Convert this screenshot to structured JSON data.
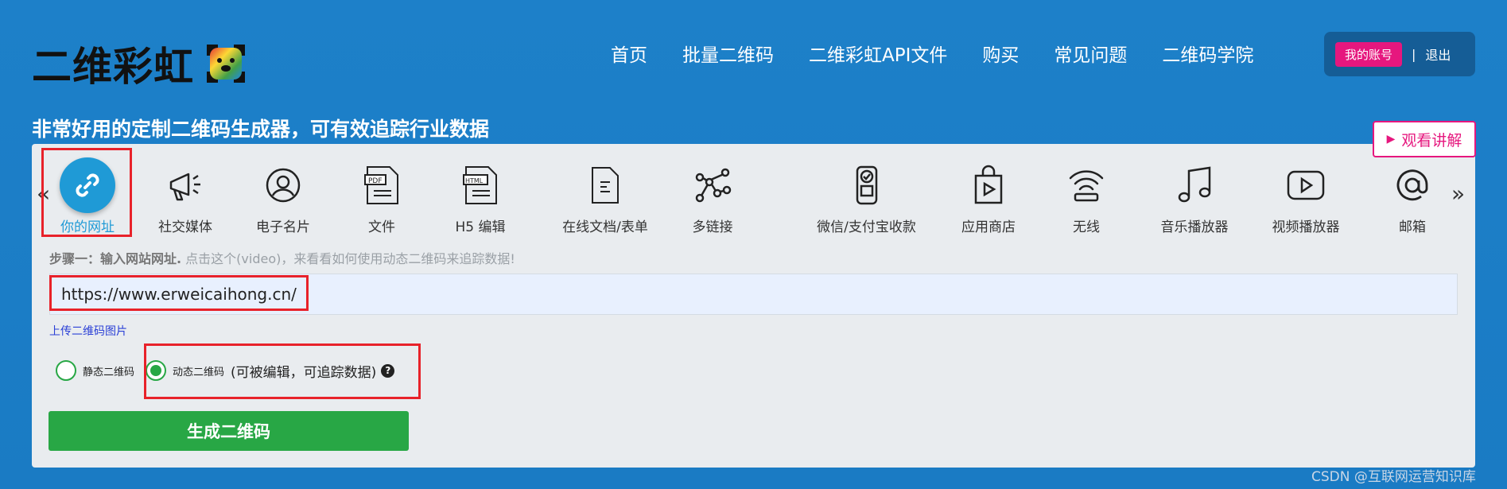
{
  "header": {
    "logo_text": "二维彩虹",
    "nav": [
      "首页",
      "批量二维码",
      "二维彩虹API文件",
      "购买",
      "常见问题",
      "二维码学院"
    ],
    "account_label": "我的账号",
    "separator": "|",
    "logout_label": "退出"
  },
  "tagline": "非常好用的定制二维码生成器，可有效追踪行业数据",
  "watch_button": "观看讲解",
  "arrows": {
    "left": "«",
    "right": "»"
  },
  "types": [
    {
      "label": "你的网址",
      "icon": "link-icon",
      "active": true
    },
    {
      "label": "社交媒体",
      "icon": "megaphone-icon"
    },
    {
      "label": "电子名片",
      "icon": "user-circle-icon"
    },
    {
      "label": "文件",
      "icon": "pdf-icon"
    },
    {
      "label": "H5 编辑",
      "icon": "html-icon"
    },
    {
      "label": "在线文档/表单",
      "icon": "document-icon"
    },
    {
      "label": "多链接",
      "icon": "network-icon"
    },
    {
      "label": "微信/支付宝收款",
      "icon": "payment-icon"
    },
    {
      "label": "应用商店",
      "icon": "app-store-icon"
    },
    {
      "label": "无线",
      "icon": "wifi-icon"
    },
    {
      "label": "音乐播放器",
      "icon": "music-icon"
    },
    {
      "label": "视频播放器",
      "icon": "video-icon"
    },
    {
      "label": "邮箱",
      "icon": "at-icon"
    }
  ],
  "step": {
    "prefix": "步骤一：输入网站网址.",
    "hint": " 点击这个(video)，来看看如何使用动态二维码来追踪数据!"
  },
  "url_value": "https://www.erweicaihong.cn/",
  "upload_label": "上传二维码图片",
  "radios": {
    "static_label": "静态二维码",
    "dynamic_label": "动态二维码",
    "dynamic_note": "(可被编辑，可追踪数据)",
    "help": "?",
    "selected": "dynamic"
  },
  "generate_label": "生成二维码",
  "watermark": "CSDN @互联网运营知识库",
  "colors": {
    "background": "#1d80c9",
    "accent_pink": "#e6177e",
    "active_blue": "#1f9ad6",
    "green": "#28a745",
    "highlight_red": "#e8222a"
  }
}
